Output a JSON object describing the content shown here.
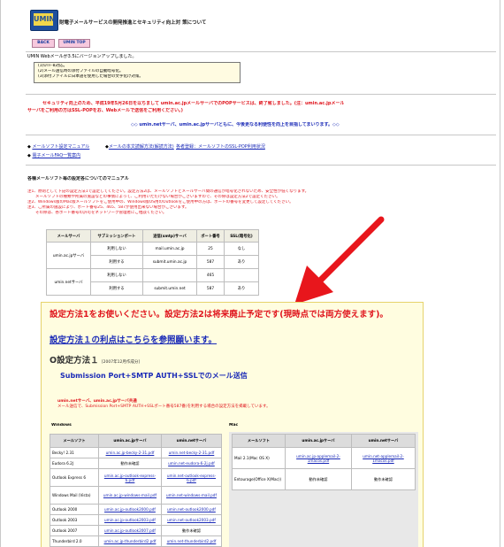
{
  "header": {
    "logo": "UMIN",
    "title": "財電子メールサービスの開発推進とセキュリティ向上対 策について"
  },
  "nav": {
    "back": "BACK",
    "top": "UMIN TOP"
  },
  "version_line": "UMIN Webメールが3.5にバージョンアップしました。",
  "version_items": [
    "(1)UTF-8対応。",
    "(2)メール送信時の添付ファイルの自動暗号化。",
    "(3)添付ファイルに日本語を使用した場合の文字化け対策。"
  ],
  "security_notice": [
    "セキュリティ向上のため、平成19年5月26日を以ちまして umin.ac.jpメールサーバでのPOPサービスは、終了致しました。(注：umin.ac.jpメール",
    "サーバをご利用の方はSSL-POPをお、Webメールで送信をご利用ください。)"
  ],
  "center_line": "◇◇ umin.netサーバ、umin.ac.jpサーバともに、今後更なる利便性を向上を目指してまいります。◇◇",
  "bullets": [
    {
      "a": "メールソフト設定マニュアル",
      "b": "メールの本文読解方法(解読方法)",
      "c": "各者登録：メールソフトのSSL-POP利用状況"
    },
    {
      "a": "電子メールFAQ一覧案内",
      "b": "",
      "c": ""
    }
  ],
  "section_title": "各種メールソフト毎の設定各についてのマニュアル",
  "section_notes": [
    "注1、原則として下記の設定方法1で設定してください。設定方法2は、メールソフトとメールサーバ間の通信が暗号化されないため、安全性が低くなります。",
    "　　メールソフトの種類や所属の施設などの事情によって、ご利用いただけない場合がございますので、その際は設定方法2で設定ください。",
    "注2、Windows版のMac版メールソフトをご使用中の、Windows版OS用のOutlookをご使用中の方は、ポートの番号を変更して設定してください。",
    "注3、ご所属の施設により、ポート番号25、465、587が使用出来ない場合がございます。",
    "　　その際は、各ポート番号の許可をネットワーク管理者にご相談ください。"
  ],
  "compare_table": {
    "headers": [
      "メールサーバ",
      "サブミッションポート",
      "送信(smtp)サーバ",
      "ポート番号",
      "SSL(暗号化)"
    ],
    "rows": [
      {
        "server": "umin.ac.jpサーバ",
        "sub": "利用しない",
        "smtp": "mail.umin.ac.jp",
        "port": "25",
        "ssl": "なし"
      },
      {
        "server": "",
        "sub": "利用する",
        "smtp": "submit.umin.ac.jp",
        "port": "587",
        "ssl": "あり"
      },
      {
        "server": "umin.netサーバ",
        "sub": "利用しない",
        "smtp": "",
        "port": "465",
        "ssl": ""
      },
      {
        "server": "",
        "sub": "利用する",
        "smtp": "submit.umin.net",
        "port": "587",
        "ssl": "あり"
      }
    ]
  },
  "warning": "設定方法1をお使いください。設定方法2は将来廃止予定です(現時点では両方使えます)。",
  "method1_link": "設定方法１の利点はこちらを参照願います。",
  "method1_title": "O設定方法１",
  "method1_date": "[2007年12月作成分]",
  "method1_subtitle": "Submission Port+SMTP AUTH+SSLでのメール送信",
  "method1_notes": [
    "umin.netサーバ、umin.ac.jpサーバ共通",
    "メール送信で、Submission Port+SMTP AUTH+SSLポート番号587番)を利用する場合の設定方法を掲載しています。"
  ],
  "win_label": "Windows",
  "mac_label": "Mac",
  "win_table": {
    "headers": [
      "メールソフト",
      "umin.ac.jpサーバ",
      "umin.netサーバ"
    ],
    "rows": [
      {
        "soft": "Becky! 2.31",
        "ac": "umin.ac.jp-becky-2-31.pdf",
        "net": "umin.net-becky-2-31.pdf"
      },
      {
        "soft": "Eudora 6.2J",
        "ac": "動作未確認",
        "net": "umin.net-eudora-6-2j.pdf"
      },
      {
        "soft": "Outlook Express 6",
        "ac": "umin.ac.jp-outlook-express-6.pdf",
        "net": "umin.net-outlook-express-6.pdf"
      },
      {
        "soft": "Windows Mail (Vista)",
        "ac": "umin.ac.jp-windows-mail.pdf",
        "net": "umin.net-windows-mail.pdf"
      },
      {
        "soft": "Outlook 2000",
        "ac": "umin.ac.jp-outlook2000.pdf",
        "net": "umin.net-outlook2000.pdf"
      },
      {
        "soft": "Outlook 2003",
        "ac": "umin.ac.jp-outlook2003.pdf",
        "net": "umin.net-outlook2003.pdf"
      },
      {
        "soft": "Outlook 2007",
        "ac": "umin.ac.jp-outlook2007.pdf",
        "net": "動作未確認"
      },
      {
        "soft": "Thunderbird 2.0",
        "ac": "umin.ac.jp-thunderbird2.pdf",
        "net": "umin.net-thunderbird2.pdf"
      }
    ]
  },
  "mac_table": {
    "headers": [
      "メールソフト",
      "umin.ac.jpサーバ",
      "umin.netサーバ"
    ],
    "rows": [
      {
        "soft": "Mail 2.1(Mac OS X)",
        "ac": "umin.ac.jp-applemail-2-1macos.pdf",
        "net": "umin.net-applemail-2-1macos.pdf"
      },
      {
        "soft": "Entourage(Office X(Mac))",
        "ac": "動作未確認",
        "net": "動作未確認"
      }
    ]
  },
  "colors": {
    "red": "#e0151d",
    "blue": "#1a2ab7",
    "yellow": "#fffde0",
    "arrow": "#e8161c"
  }
}
